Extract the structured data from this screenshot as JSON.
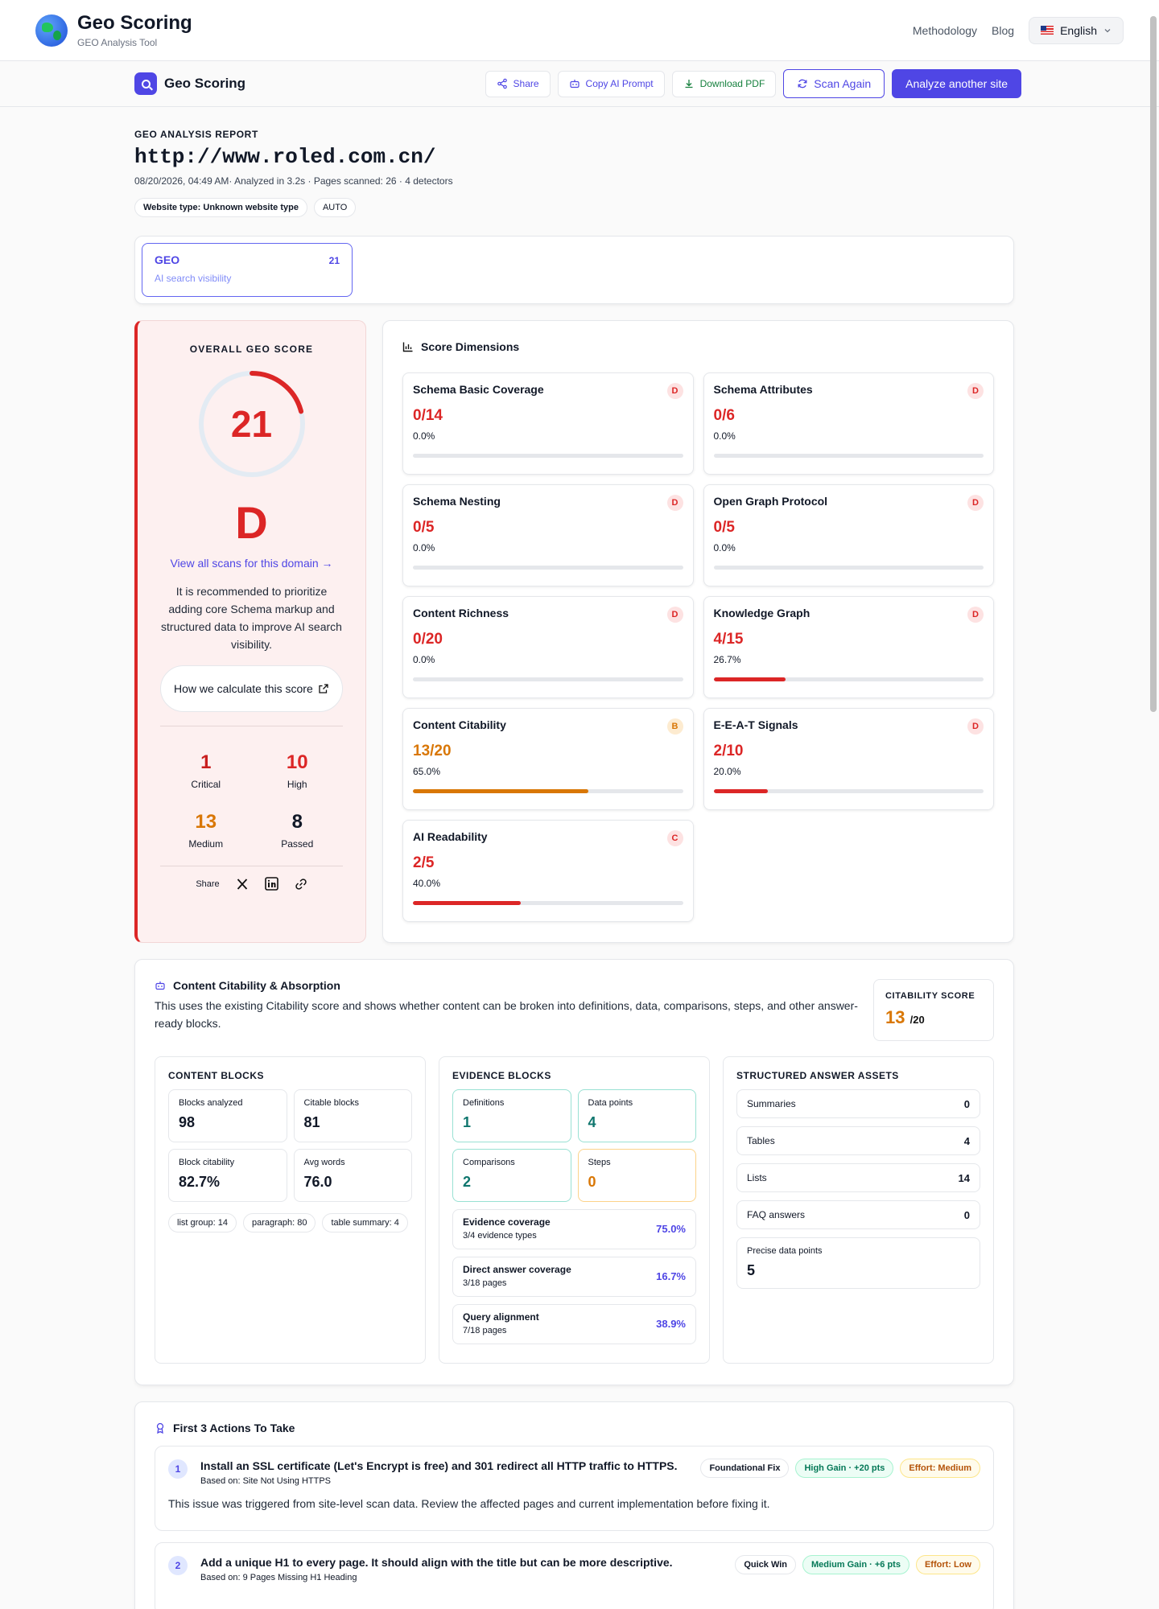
{
  "app": {
    "name": "Geo Scoring",
    "subtitle": "GEO Analysis Tool"
  },
  "nav": {
    "methodology": "Methodology",
    "blog": "Blog",
    "language": "English"
  },
  "toolbar": {
    "title": "Geo Scoring",
    "share": "Share",
    "copy_prompt": "Copy AI Prompt",
    "download_pdf": "Download PDF",
    "scan_again": "Scan Again",
    "analyze_another": "Analyze another site"
  },
  "report": {
    "eyebrow": "GEO ANALYSIS REPORT",
    "url": "http://www.roled.com.cn/",
    "meta": "08/20/2026, 04:49 AM· Analyzed in 3.2s · Pages scanned: 26 · 4 detectors",
    "website_type_label": "Website type:",
    "website_type_value": "Unknown website type",
    "mode": "AUTO"
  },
  "tabs": [
    {
      "name": "GEO",
      "score": "21",
      "sub": "AI search visibility"
    }
  ],
  "overall": {
    "title": "OVERALL GEO SCORE",
    "score": 21,
    "score_max": 100,
    "grade": "D",
    "view_link": "View all scans for this domain →",
    "recommendation": "It is recommended to prioritize adding core Schema markup and structured data to improve AI search visibility.",
    "how_label": "How we calculate this score",
    "stats": [
      {
        "value": "1",
        "label": "Critical",
        "color": "#c81e1e"
      },
      {
        "value": "10",
        "label": "High",
        "color": "#dc2626"
      },
      {
        "value": "13",
        "label": "Medium",
        "color": "#d97706"
      },
      {
        "value": "8",
        "label": "Passed",
        "color": "#111827"
      }
    ],
    "share_label": "Share"
  },
  "dimensions": {
    "title": "Score Dimensions",
    "items": [
      {
        "name": "Schema Basic Coverage",
        "value": "0/14",
        "pct": "0.0%",
        "fraction": 0.0,
        "grade": "D",
        "color": "#dc2626"
      },
      {
        "name": "Schema Attributes",
        "value": "0/6",
        "pct": "0.0%",
        "fraction": 0.0,
        "grade": "D",
        "color": "#dc2626"
      },
      {
        "name": "Schema Nesting",
        "value": "0/5",
        "pct": "0.0%",
        "fraction": 0.0,
        "grade": "D",
        "color": "#dc2626"
      },
      {
        "name": "Open Graph Protocol",
        "value": "0/5",
        "pct": "0.0%",
        "fraction": 0.0,
        "grade": "D",
        "color": "#dc2626"
      },
      {
        "name": "Content Richness",
        "value": "0/20",
        "pct": "0.0%",
        "fraction": 0.0,
        "grade": "D",
        "color": "#dc2626"
      },
      {
        "name": "Knowledge Graph",
        "value": "4/15",
        "pct": "26.7%",
        "fraction": 0.267,
        "grade": "D",
        "color": "#dc2626"
      },
      {
        "name": "Content Citability",
        "value": "13/20",
        "pct": "65.0%",
        "fraction": 0.65,
        "grade": "B",
        "color": "#d97706"
      },
      {
        "name": "E-E-A-T Signals",
        "value": "2/10",
        "pct": "20.0%",
        "fraction": 0.2,
        "grade": "D",
        "color": "#dc2626"
      },
      {
        "name": "AI Readability",
        "value": "2/5",
        "pct": "40.0%",
        "fraction": 0.4,
        "grade": "C",
        "color": "#dc2626"
      }
    ]
  },
  "citability": {
    "title": "Content Citability & Absorption",
    "desc": "This uses the existing Citability score and shows whether content can be broken into definitions, data, comparisons, steps, and other answer-ready blocks.",
    "score_label": "CITABILITY SCORE",
    "score": "13",
    "score_max": "/20",
    "content_blocks": {
      "title": "CONTENT BLOCKS",
      "items": [
        {
          "label": "Blocks analyzed",
          "value": "98"
        },
        {
          "label": "Citable blocks",
          "value": "81"
        },
        {
          "label": "Block citability",
          "value": "82.7%"
        },
        {
          "label": "Avg words",
          "value": "76.0"
        }
      ],
      "chips": [
        "list group: 14",
        "paragraph: 80",
        "table summary: 4"
      ]
    },
    "evidence_blocks": {
      "title": "EVIDENCE BLOCKS",
      "items": [
        {
          "label": "Definitions",
          "value": "1"
        },
        {
          "label": "Data points",
          "value": "4"
        },
        {
          "label": "Comparisons",
          "value": "2"
        },
        {
          "label": "Steps",
          "value": "0"
        }
      ],
      "coverage": [
        {
          "title": "Evidence coverage",
          "sub": "3/4 evidence types",
          "value": "75.0%"
        },
        {
          "title": "Direct answer coverage",
          "sub": "3/18 pages",
          "value": "16.7%"
        },
        {
          "title": "Query alignment",
          "sub": "7/18 pages",
          "value": "38.9%"
        }
      ]
    },
    "assets": {
      "title": "STRUCTURED ANSWER ASSETS",
      "items": [
        {
          "label": "Summaries",
          "value": "0"
        },
        {
          "label": "Tables",
          "value": "4"
        },
        {
          "label": "Lists",
          "value": "14"
        },
        {
          "label": "FAQ answers",
          "value": "0"
        }
      ],
      "precise": {
        "label": "Precise data points",
        "value": "5"
      }
    }
  },
  "actions": {
    "title": "First 3 Actions To Take",
    "items": [
      {
        "num": "1",
        "title": "Install an SSL certificate (Let's Encrypt is free) and 301 redirect all HTTP traffic to HTTPS.",
        "based": "Based on: Site Not Using HTTPS",
        "desc": "This issue was triggered from site-level scan data. Review the affected pages and current implementation before fixing it.",
        "type": "Foundational Fix",
        "gain": "High Gain · +20 pts",
        "effort": "Effort: Medium"
      },
      {
        "num": "2",
        "title": "Add a unique H1 to every page. It should align with the title but can be more descriptive.",
        "based": "Based on: 9 Pages Missing H1 Heading",
        "desc": "",
        "type": "Quick Win",
        "gain": "Medium Gain · +6 pts",
        "effort": "Effort: Low"
      }
    ]
  }
}
